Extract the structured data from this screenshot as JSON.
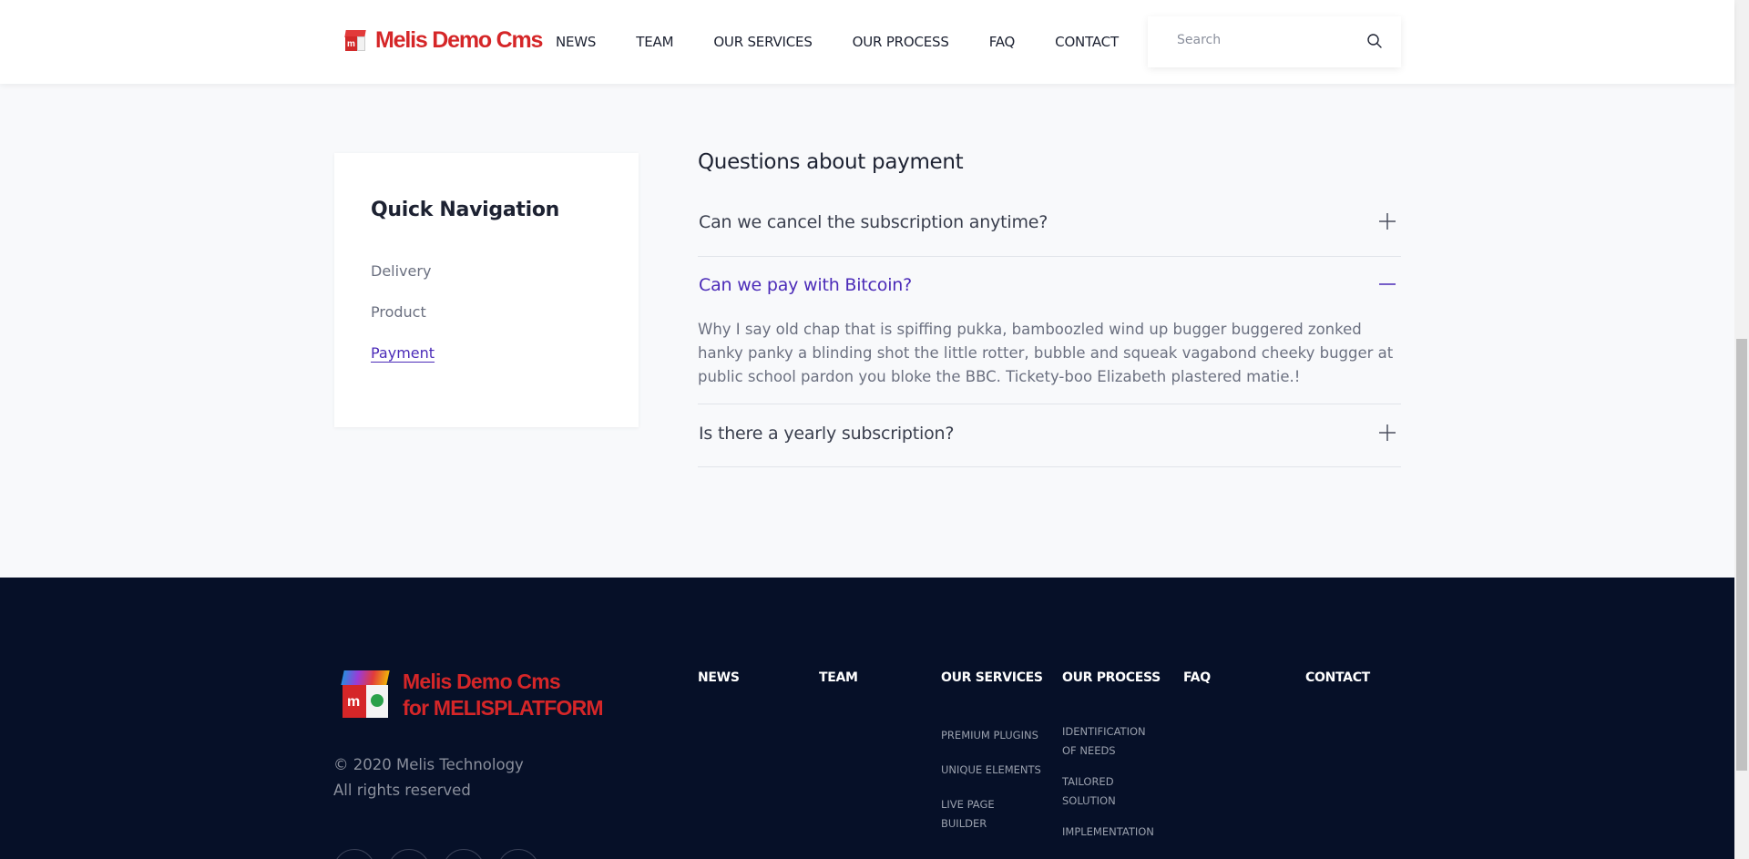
{
  "header": {
    "logo_text": "Melis Demo Cms",
    "nav": [
      "NEWS",
      "TEAM",
      "OUR SERVICES",
      "OUR PROCESS",
      "FAQ",
      "CONTACT"
    ],
    "search_placeholder": "Search"
  },
  "quick_nav": {
    "title": "Quick Navigation",
    "items": [
      "Delivery",
      "Product",
      "Payment"
    ],
    "active": "Payment"
  },
  "faq": {
    "title": "Questions about payment",
    "items": [
      {
        "question": "Can we cancel the subscription anytime?",
        "open": false
      },
      {
        "question": "Can we pay with Bitcoin?",
        "open": true,
        "answer": "Why I say old chap that is spiffing pukka, bamboozled wind up bugger buggered zonked hanky panky a blinding shot the little rotter, bubble and squeak vagabond cheeky bugger at public school pardon you bloke the BBC. Tickety-boo Elizabeth plastered matie.!"
      },
      {
        "question": "Is there a yearly subscription?",
        "open": false
      }
    ]
  },
  "footer": {
    "logo_line1": "Melis Demo Cms",
    "logo_line2": "for MELISPLATFORM",
    "copyright_line1": "© 2020 Melis Technology",
    "copyright_line2": "All rights reserved",
    "columns": [
      {
        "title": "NEWS",
        "items": []
      },
      {
        "title": "TEAM",
        "items": []
      },
      {
        "title": "OUR SERVICES",
        "items": [
          "PREMIUM PLUGINS",
          "UNIQUE ELEMENTS",
          "LIVE PAGE BUILDER"
        ]
      },
      {
        "title": "OUR PROCESS",
        "items": [
          "IDENTIFICATION OF NEEDS",
          "TAILORED SOLUTION",
          "IMPLEMENTATION"
        ]
      },
      {
        "title": "FAQ",
        "items": []
      },
      {
        "title": "CONTACT",
        "items": []
      }
    ]
  },
  "colors": {
    "brand_red": "#d52628",
    "accent_purple": "#4b2bb8",
    "footer_bg": "#061028"
  }
}
